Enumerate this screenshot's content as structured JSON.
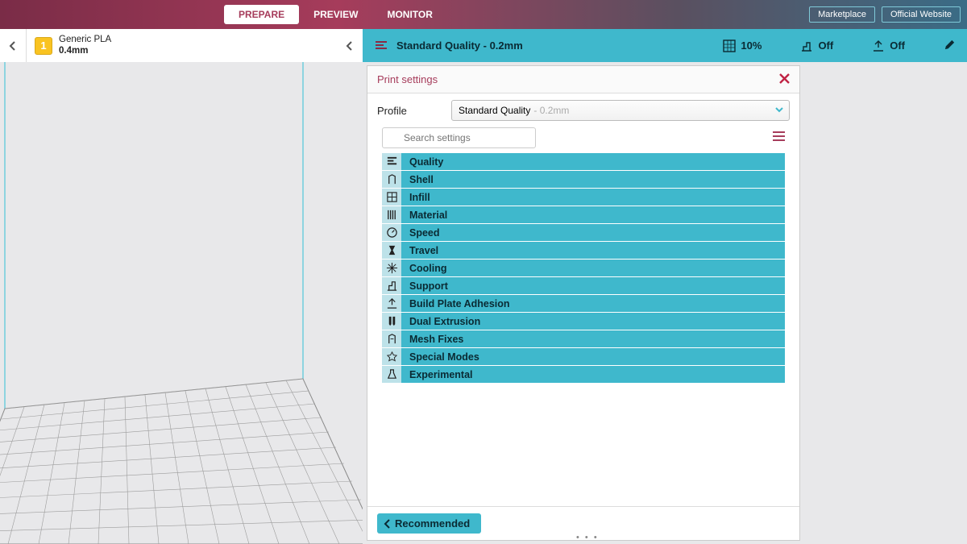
{
  "topbar": {
    "tabs": [
      {
        "label": "PREPARE",
        "active": true
      },
      {
        "label": "PREVIEW",
        "active": false
      },
      {
        "label": "MONITOR",
        "active": false
      }
    ],
    "links": {
      "marketplace": "Marketplace",
      "official_website": "Official Website"
    }
  },
  "material_bar": {
    "material": "Generic PLA",
    "nozzle": "0.4mm"
  },
  "summary_bar": {
    "profile_name": "Standard Quality - 0.2mm",
    "infill": "10%",
    "support": "Off",
    "adhesion": "Off"
  },
  "panel": {
    "title": "Print settings",
    "profile_label": "Profile",
    "profile_selected": "Standard Quality",
    "profile_suffix": "- 0.2mm",
    "search_placeholder": "Search settings",
    "categories": [
      "Quality",
      "Shell",
      "Infill",
      "Material",
      "Speed",
      "Travel",
      "Cooling",
      "Support",
      "Build Plate Adhesion",
      "Dual Extrusion",
      "Mesh Fixes",
      "Special Modes",
      "Experimental"
    ],
    "recommended_button": "Recommended"
  },
  "colors": {
    "accent": "#3fb8cc",
    "brand": "#a63c5b"
  }
}
